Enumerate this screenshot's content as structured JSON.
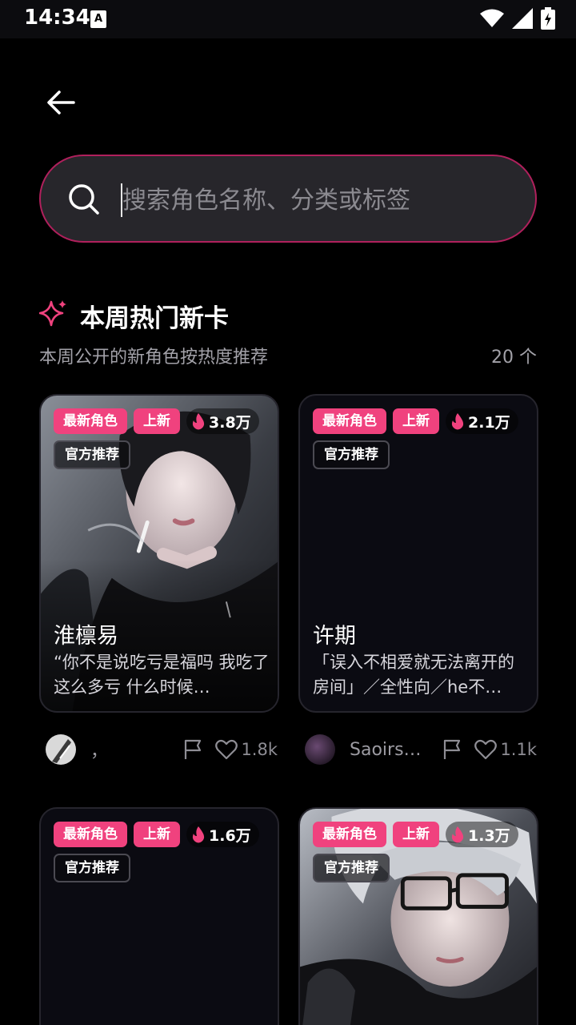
{
  "status": {
    "time": "14:34",
    "keyboard_icon": "A"
  },
  "search": {
    "placeholder": "搜索角色名称、分类或标签"
  },
  "section": {
    "title": "本周热门新卡",
    "subtitle": "本周公开的新角色按热度推荐",
    "count": "20 个"
  },
  "badges": {
    "newest": "最新角色",
    "new": "上新",
    "official": "官方推荐"
  },
  "cards": [
    {
      "name": "淮檩易",
      "desc": "“你不是说吃亏是福吗 我吃了这么多亏 什么时候…",
      "heat": "3.8万",
      "author": "，",
      "likes": "1.8k"
    },
    {
      "name": "许期",
      "desc": "「误入不相爱就无法离开的房间」／全性向／he不…",
      "heat": "2.1万",
      "author": "Saoirs…",
      "likes": "1.1k"
    },
    {
      "name": "",
      "desc": "",
      "heat": "1.6万",
      "author": "",
      "likes": ""
    },
    {
      "name": "",
      "desc": "",
      "heat": "1.3万",
      "author": "",
      "likes": ""
    }
  ],
  "colors": {
    "accent": "#f0427e",
    "search_border": "#b0205c",
    "background": "#000000"
  }
}
